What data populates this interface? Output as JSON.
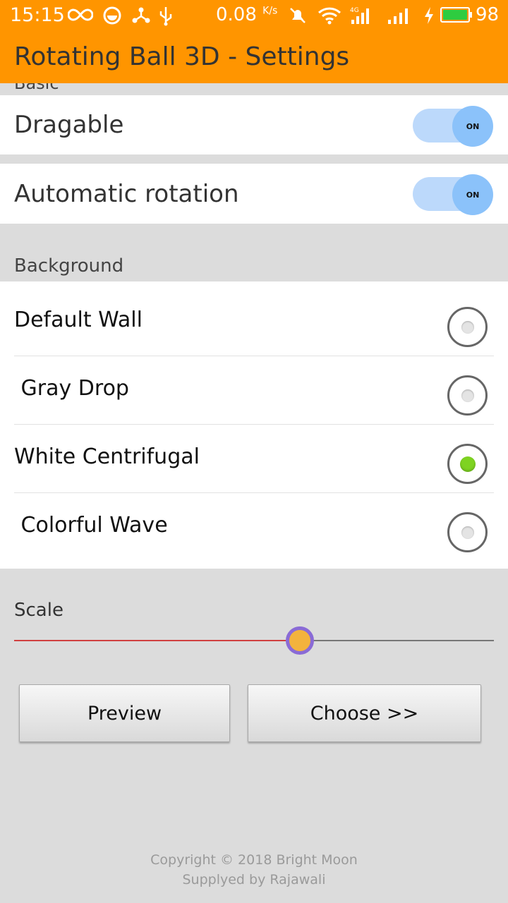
{
  "status_bar": {
    "time": "15:15",
    "net_speed": "0.08",
    "net_speed_unit": "K/s",
    "battery_level": "98",
    "icons": [
      "infinity-icon",
      "app-notification-icon",
      "share-icon",
      "usb-icon",
      "mute-bell-icon",
      "wifi-icon",
      "cellular-4g-icon",
      "cellular-icon",
      "charging-icon",
      "battery-icon"
    ]
  },
  "app_bar": {
    "title": "Rotating Ball 3D - Settings",
    "color": "#ff9500"
  },
  "basic": {
    "category": "Basic",
    "dragable": {
      "label": "Dragable",
      "state": "ON"
    },
    "automatic_rotation": {
      "label": "Automatic rotation",
      "state": "ON"
    }
  },
  "background": {
    "category": "Background",
    "options": [
      {
        "label": "Default Wall",
        "checked": false
      },
      {
        "label": " Gray Drop",
        "checked": false
      },
      {
        "label": "White Centrifugal",
        "checked": true
      },
      {
        "label": " Colorful Wave",
        "checked": false
      }
    ]
  },
  "scale": {
    "label": "Scale",
    "value_fraction": 0.595
  },
  "buttons": {
    "preview": "Preview",
    "choose": "Choose >>"
  },
  "footer": {
    "copyright": "Copyright © 2018 Bright Moon",
    "supplied_by": "Supplyed by Rajawali"
  }
}
